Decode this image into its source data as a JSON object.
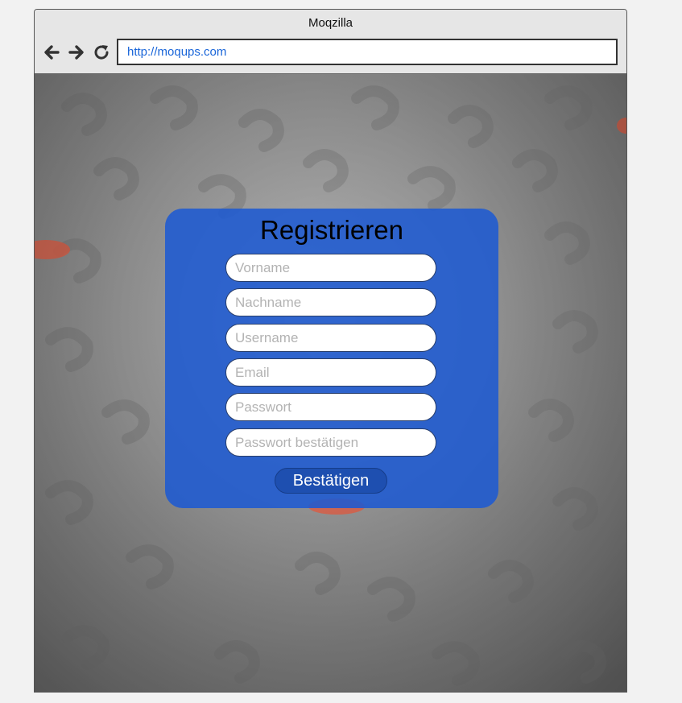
{
  "window": {
    "title": "Moqzilla",
    "url": "http://moqups.com"
  },
  "icons": {
    "back": "arrow-left-icon",
    "forward": "arrow-right-icon",
    "reload": "reload-icon"
  },
  "form": {
    "title": "Registrieren",
    "fields": [
      {
        "placeholder": "Vorname",
        "value": ""
      },
      {
        "placeholder": "Nachname",
        "value": ""
      },
      {
        "placeholder": "Username",
        "value": ""
      },
      {
        "placeholder": "Email",
        "value": ""
      },
      {
        "placeholder": "Passwort",
        "value": ""
      },
      {
        "placeholder": "Passwort bestätigen",
        "value": ""
      }
    ],
    "submit_label": "Bestätigen"
  },
  "colors": {
    "card": "#1e5ad2",
    "button": "#1e4fb0",
    "url_text": "#1a66d9"
  }
}
